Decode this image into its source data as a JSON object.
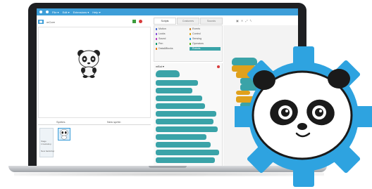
{
  "menu": {
    "items": [
      "File ▾",
      "Edit ▾",
      "Extensions ▾",
      "Help ▾"
    ]
  },
  "stage": {
    "title": "mCore"
  },
  "sprites": {
    "label": "Sprites",
    "new_sprite": "New sprite:",
    "stage_label": "Stage\n1 backdrop",
    "new_backdrop": "New backdrop:"
  },
  "palette": {
    "tabs": [
      "Scripts",
      "Costumes",
      "Sounds"
    ],
    "categories_left": [
      "Motion",
      "Looks",
      "Sound",
      "Pen",
      "Data&Blocks"
    ],
    "categories_right": [
      "Events",
      "Control",
      "Sensing",
      "Operators",
      "Robots"
    ],
    "section": "mBot ▾"
  },
  "colors": {
    "menubar": "#3d9ed8",
    "robots_block": "#3aa3a8",
    "events_block": "#e6a820",
    "control_block": "#e0a11c",
    "gear": "#2ea3e0"
  },
  "icons": [
    "green-flag-icon",
    "stop-icon",
    "gear-panda-icon"
  ]
}
